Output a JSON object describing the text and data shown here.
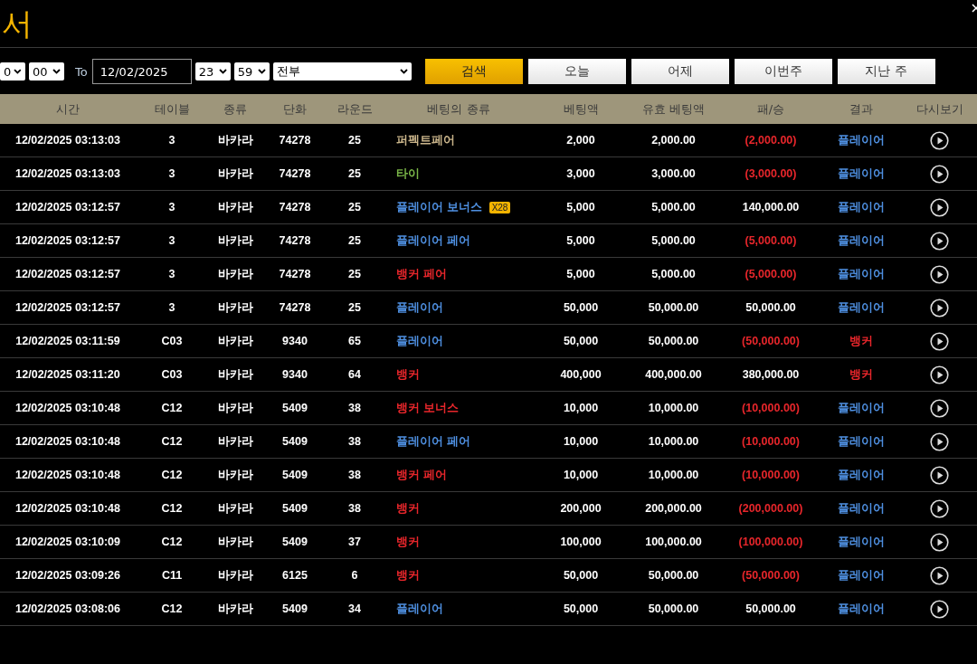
{
  "title": "서",
  "filters": {
    "start_hour": "0",
    "start_minute": "00",
    "to_label": "To",
    "end_date": "12/02/2025",
    "end_hour": "23",
    "end_minute": "59",
    "game_filter": "전부",
    "search_button": "검색",
    "quick_buttons": [
      "오늘",
      "어제",
      "이번주",
      "지난 주"
    ]
  },
  "table": {
    "columns": [
      "시간",
      "테이블",
      "종류",
      "단화",
      "라운드",
      "베팅의 종류",
      "베팅액",
      "유효 베팅액",
      "패/승",
      "결과",
      "다시보기"
    ],
    "rows": [
      {
        "time": "12/02/2025 03:13:03",
        "table": "3",
        "game": "바카라",
        "shoe": "74278",
        "round": "25",
        "bet": {
          "label": "퍼펙트페어",
          "color": "#c9b48a"
        },
        "bet_amount": "2,000",
        "valid_bet": "2,000.00",
        "win_loss": "(2,000.00)",
        "loss": true,
        "result": {
          "label": "플레이어",
          "color": "#4e8fe0"
        }
      },
      {
        "time": "12/02/2025 03:13:03",
        "table": "3",
        "game": "바카라",
        "shoe": "74278",
        "round": "25",
        "bet": {
          "label": "타이",
          "color": "#7ab648"
        },
        "bet_amount": "3,000",
        "valid_bet": "3,000.00",
        "win_loss": "(3,000.00)",
        "loss": true,
        "result": {
          "label": "플레이어",
          "color": "#4e8fe0"
        }
      },
      {
        "time": "12/02/2025 03:12:57",
        "table": "3",
        "game": "바카라",
        "shoe": "74278",
        "round": "25",
        "bet": {
          "label": "플레이어 보너스",
          "color": "#4e8fe0"
        },
        "multiplier": "X28",
        "bet_amount": "5,000",
        "valid_bet": "5,000.00",
        "win_loss": "140,000.00",
        "loss": false,
        "result": {
          "label": "플레이어",
          "color": "#4e8fe0"
        }
      },
      {
        "time": "12/02/2025 03:12:57",
        "table": "3",
        "game": "바카라",
        "shoe": "74278",
        "round": "25",
        "bet": {
          "label": "플레이어 페어",
          "color": "#4e8fe0"
        },
        "bet_amount": "5,000",
        "valid_bet": "5,000.00",
        "win_loss": "(5,000.00)",
        "loss": true,
        "result": {
          "label": "플레이어",
          "color": "#4e8fe0"
        }
      },
      {
        "time": "12/02/2025 03:12:57",
        "table": "3",
        "game": "바카라",
        "shoe": "74278",
        "round": "25",
        "bet": {
          "label": "뱅커 페어",
          "color": "#e8262b"
        },
        "bet_amount": "5,000",
        "valid_bet": "5,000.00",
        "win_loss": "(5,000.00)",
        "loss": true,
        "result": {
          "label": "플레이어",
          "color": "#4e8fe0"
        }
      },
      {
        "time": "12/02/2025 03:12:57",
        "table": "3",
        "game": "바카라",
        "shoe": "74278",
        "round": "25",
        "bet": {
          "label": "플레이어",
          "color": "#4e8fe0"
        },
        "bet_amount": "50,000",
        "valid_bet": "50,000.00",
        "win_loss": "50,000.00",
        "loss": false,
        "result": {
          "label": "플레이어",
          "color": "#4e8fe0"
        }
      },
      {
        "time": "12/02/2025 03:11:59",
        "table": "C03",
        "game": "바카라",
        "shoe": "9340",
        "round": "65",
        "bet": {
          "label": "플레이어",
          "color": "#4e8fe0"
        },
        "bet_amount": "50,000",
        "valid_bet": "50,000.00",
        "win_loss": "(50,000.00)",
        "loss": true,
        "result": {
          "label": "뱅커",
          "color": "#e8262b"
        }
      },
      {
        "time": "12/02/2025 03:11:20",
        "table": "C03",
        "game": "바카라",
        "shoe": "9340",
        "round": "64",
        "bet": {
          "label": "뱅커",
          "color": "#e8262b"
        },
        "bet_amount": "400,000",
        "valid_bet": "400,000.00",
        "win_loss": "380,000.00",
        "loss": false,
        "result": {
          "label": "뱅커",
          "color": "#e8262b"
        }
      },
      {
        "time": "12/02/2025 03:10:48",
        "table": "C12",
        "game": "바카라",
        "shoe": "5409",
        "round": "38",
        "bet": {
          "label": "뱅커 보너스",
          "color": "#e8262b"
        },
        "bet_amount": "10,000",
        "valid_bet": "10,000.00",
        "win_loss": "(10,000.00)",
        "loss": true,
        "result": {
          "label": "플레이어",
          "color": "#4e8fe0"
        }
      },
      {
        "time": "12/02/2025 03:10:48",
        "table": "C12",
        "game": "바카라",
        "shoe": "5409",
        "round": "38",
        "bet": {
          "label": "플레이어 페어",
          "color": "#4e8fe0"
        },
        "bet_amount": "10,000",
        "valid_bet": "10,000.00",
        "win_loss": "(10,000.00)",
        "loss": true,
        "result": {
          "label": "플레이어",
          "color": "#4e8fe0"
        }
      },
      {
        "time": "12/02/2025 03:10:48",
        "table": "C12",
        "game": "바카라",
        "shoe": "5409",
        "round": "38",
        "bet": {
          "label": "뱅커 페어",
          "color": "#e8262b"
        },
        "bet_amount": "10,000",
        "valid_bet": "10,000.00",
        "win_loss": "(10,000.00)",
        "loss": true,
        "result": {
          "label": "플레이어",
          "color": "#4e8fe0"
        }
      },
      {
        "time": "12/02/2025 03:10:48",
        "table": "C12",
        "game": "바카라",
        "shoe": "5409",
        "round": "38",
        "bet": {
          "label": "뱅커",
          "color": "#e8262b"
        },
        "bet_amount": "200,000",
        "valid_bet": "200,000.00",
        "win_loss": "(200,000.00)",
        "loss": true,
        "result": {
          "label": "플레이어",
          "color": "#4e8fe0"
        }
      },
      {
        "time": "12/02/2025 03:10:09",
        "table": "C12",
        "game": "바카라",
        "shoe": "5409",
        "round": "37",
        "bet": {
          "label": "뱅커",
          "color": "#e8262b"
        },
        "bet_amount": "100,000",
        "valid_bet": "100,000.00",
        "win_loss": "(100,000.00)",
        "loss": true,
        "result": {
          "label": "플레이어",
          "color": "#4e8fe0"
        }
      },
      {
        "time": "12/02/2025 03:09:26",
        "table": "C11",
        "game": "바카라",
        "shoe": "6125",
        "round": "6",
        "bet": {
          "label": "뱅커",
          "color": "#e8262b"
        },
        "bet_amount": "50,000",
        "valid_bet": "50,000.00",
        "win_loss": "(50,000.00)",
        "loss": true,
        "result": {
          "label": "플레이어",
          "color": "#4e8fe0"
        }
      },
      {
        "time": "12/02/2025 03:08:06",
        "table": "C12",
        "game": "바카라",
        "shoe": "5409",
        "round": "34",
        "bet": {
          "label": "플레이어",
          "color": "#4e8fe0"
        },
        "bet_amount": "50,000",
        "valid_bet": "50,000.00",
        "win_loss": "50,000.00",
        "loss": false,
        "result": {
          "label": "플레이어",
          "color": "#4e8fe0"
        }
      }
    ]
  }
}
